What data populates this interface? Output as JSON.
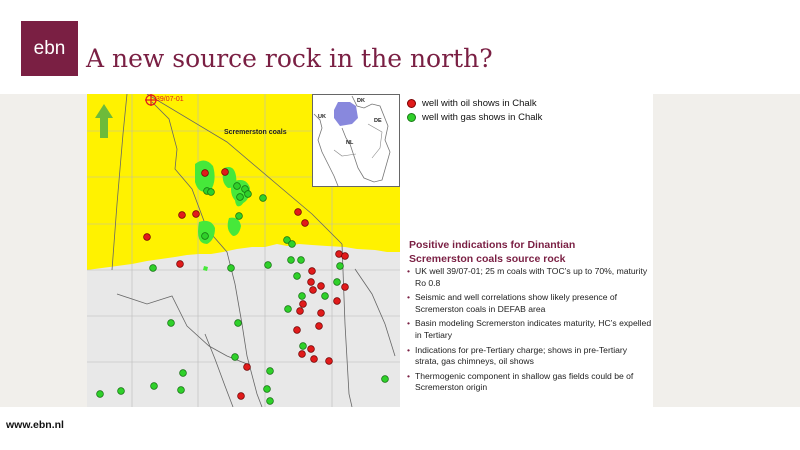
{
  "header": {
    "logo_text": "ebn",
    "title": "A new source rock in the north?",
    "brand_color": "#7a1f43"
  },
  "map": {
    "well_label": "39/07-01",
    "area_label": "Scremerston coals",
    "inset_labels": {
      "dk": "DK",
      "uk": "UK",
      "de": "DE",
      "nl": "NL"
    },
    "north_arrow_icon": "north-arrow-icon",
    "colors": {
      "coal_area": "#fff200",
      "background": "#e8e8e8",
      "oil": "#e01b1b",
      "gas": "#2fd02a",
      "inset_area": "#8888dd"
    }
  },
  "legend": {
    "oil_label": "well with oil shows in Chalk",
    "gas_label": "well with gas shows in Chalk"
  },
  "content": {
    "heading_line1": "Positive  indications for Dinantian",
    "heading_line2": "Scremerston coals source rock",
    "bullets": [
      "UK well 39/07-01; 25 m coals with TOC’s up to 70%, maturity Ro 0.8",
      "Seismic and well correlations show likely presence of Scremerston coals in DEFAB area",
      "Basin modeling Scremerston indicates maturity, HC’s expelled in Tertiary",
      "Indications for pre-Tertiary charge; shows in pre-Tertiary strata, gas chimneys, oil shows",
      "Thermogenic component in shallow gas fields could be of Scremerston origin"
    ]
  },
  "footer": {
    "url": "www.ebn.nl"
  }
}
